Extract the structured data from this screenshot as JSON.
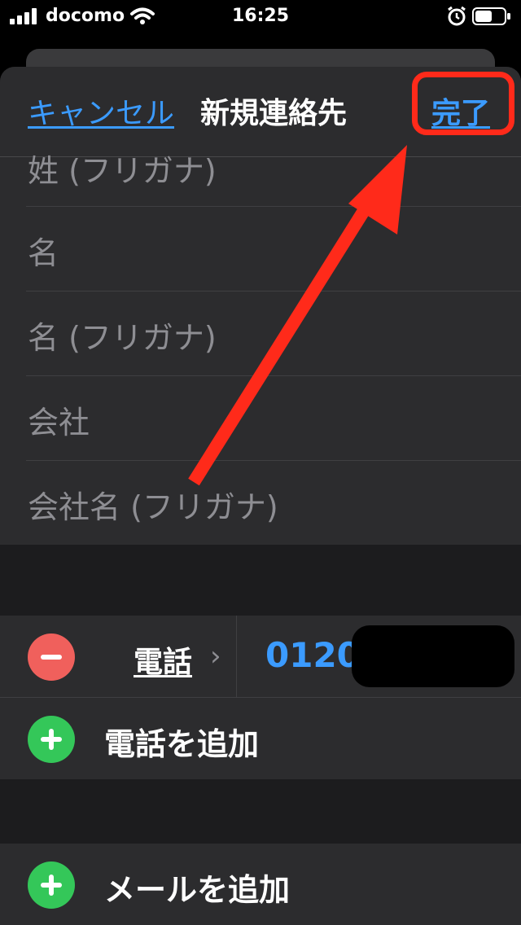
{
  "status_bar": {
    "carrier": "docomo",
    "time": "16:25"
  },
  "nav": {
    "cancel_label": "キャンセル",
    "title": "新規連絡先",
    "done_label": "完了"
  },
  "name_fields": [
    {
      "placeholder": "姓 (フリガナ)"
    },
    {
      "placeholder": "名"
    },
    {
      "placeholder": "名 (フリガナ)"
    },
    {
      "placeholder": "会社"
    },
    {
      "placeholder": "会社名 (フリガナ)"
    }
  ],
  "phone": {
    "type_label": "電話",
    "number": "0120",
    "add_label": "電話を追加"
  },
  "email": {
    "add_label": "メールを追加"
  },
  "colors": {
    "accent": "#3b9bff",
    "annotation": "#ff2a1a",
    "delete": "#f0605c",
    "add": "#34c759"
  }
}
